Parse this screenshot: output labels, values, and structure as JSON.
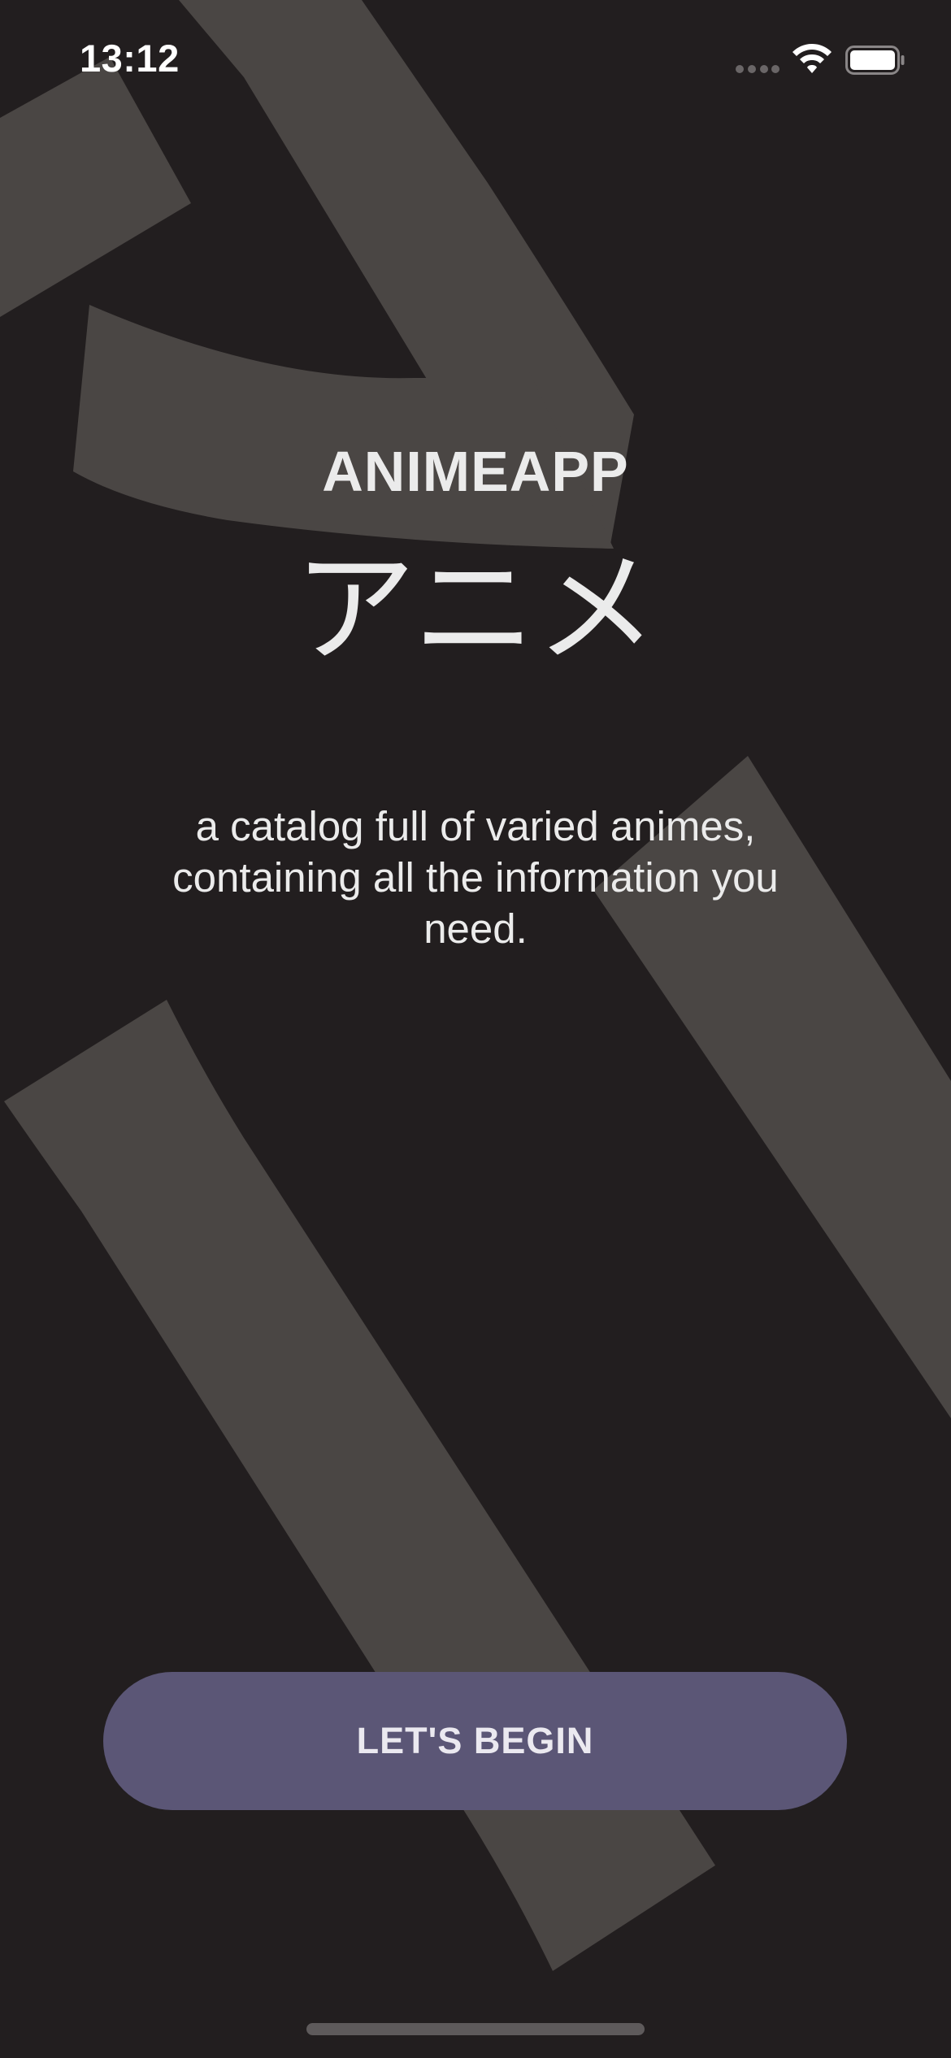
{
  "status_bar": {
    "time": "13:12",
    "icons": [
      "cellular-signal-icon",
      "wifi-icon",
      "battery-icon"
    ]
  },
  "app": {
    "title": "ANIMEAPP",
    "title_jp": "アニメ",
    "description": "a catalog full of varied animes, containing all the information you need."
  },
  "actions": {
    "begin_label": "LET'S BEGIN"
  },
  "colors": {
    "background": "#221e1f",
    "background_art": "#4a4644",
    "text": "#ebebeb",
    "button": "#5b5676"
  }
}
